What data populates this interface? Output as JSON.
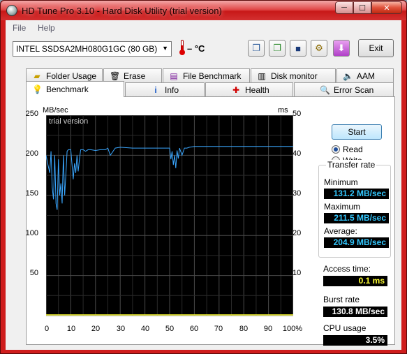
{
  "window": {
    "title": "HD Tune Pro 3.10 - Hard Disk Utility (trial version)",
    "minimize": "─",
    "maximize": "☐",
    "close": "✕"
  },
  "menu": {
    "file": "File",
    "help": "Help"
  },
  "toolbar": {
    "drive": "INTEL SSDSA2MH080G1GC (80 GB)",
    "temperature": "– °C",
    "exit_label": "Exit",
    "icons": [
      "copy-icon",
      "copy-info-icon",
      "save-icon",
      "options-icon",
      "download-icon"
    ]
  },
  "tabs": {
    "row1": [
      {
        "label": "Folder Usage",
        "icon": "folder-icon"
      },
      {
        "label": "Erase",
        "icon": "trash-icon"
      },
      {
        "label": "File Benchmark",
        "icon": "file-benchmark-icon"
      },
      {
        "label": "Disk monitor",
        "icon": "disk-monitor-icon"
      },
      {
        "label": "AAM",
        "icon": "speaker-icon"
      }
    ],
    "row2": [
      {
        "label": "Benchmark",
        "icon": "benchmark-icon",
        "active": true
      },
      {
        "label": "Info",
        "icon": "info-icon"
      },
      {
        "label": "Health",
        "icon": "health-icon"
      },
      {
        "label": "Error Scan",
        "icon": "magnifier-icon"
      }
    ]
  },
  "benchmark": {
    "start_label": "Start",
    "read_label": "Read",
    "write_label": "Write",
    "mode": "read",
    "transfer_rate_title": "Transfer rate",
    "minimum_label": "Minimum",
    "minimum_value": "131.2 MB/sec",
    "maximum_label": "Maximum",
    "maximum_value": "211.5 MB/sec",
    "average_label": "Average:",
    "average_value": "204.9 MB/sec",
    "access_time_label": "Access time:",
    "access_time_value": "0.1 ms",
    "burst_rate_label": "Burst rate",
    "burst_rate_value": "130.8 MB/sec",
    "cpu_usage_label": "CPU usage",
    "cpu_usage_value": "3.5%"
  },
  "chart_data": {
    "type": "line",
    "watermark": "trial version",
    "ylabel_left": "MB/sec",
    "ylabel_right": "ms",
    "yticks_left": [
      "250",
      "200",
      "150",
      "100",
      "50"
    ],
    "yticks_right": [
      "50",
      "40",
      "30",
      "20",
      "10"
    ],
    "xticks": [
      "0",
      "10",
      "20",
      "30",
      "40",
      "50",
      "60",
      "70",
      "80",
      "90",
      "100%"
    ],
    "ylim": [
      0,
      250
    ],
    "xlim": [
      0,
      100
    ],
    "grid": true,
    "series": [
      {
        "name": "transfer rate",
        "color": "#3aa7ff",
        "x": [
          0,
          0.5,
          1,
          1.5,
          2,
          2.5,
          3,
          3.5,
          4,
          4.5,
          5,
          5.5,
          6,
          6.5,
          7,
          7.5,
          8,
          8.5,
          9,
          10,
          11,
          11.5,
          12,
          12.5,
          13,
          13.5,
          14,
          15,
          16,
          17,
          18,
          20,
          22,
          24,
          25,
          26,
          28,
          30,
          35,
          40,
          45,
          50,
          50.5,
          51,
          51.5,
          52,
          52.5,
          53,
          53.5,
          54,
          55,
          56,
          57,
          58,
          60,
          70,
          80,
          90,
          100
        ],
        "y": [
          200,
          192,
          185,
          178,
          205,
          160,
          145,
          200,
          140,
          132,
          195,
          150,
          165,
          140,
          200,
          150,
          175,
          205,
          207,
          207,
          170,
          190,
          178,
          200,
          180,
          195,
          207,
          207,
          205,
          207,
          207,
          206,
          207,
          207,
          209,
          200,
          209,
          210,
          209,
          209,
          209,
          209,
          195,
          205,
          188,
          200,
          184,
          206,
          196,
          209,
          200,
          209,
          209,
          210,
          211,
          211,
          211,
          211,
          211
        ]
      },
      {
        "name": "access time",
        "color": "#ffff33",
        "x": [
          0,
          100
        ],
        "y": [
          0.1,
          0.1
        ]
      }
    ]
  }
}
